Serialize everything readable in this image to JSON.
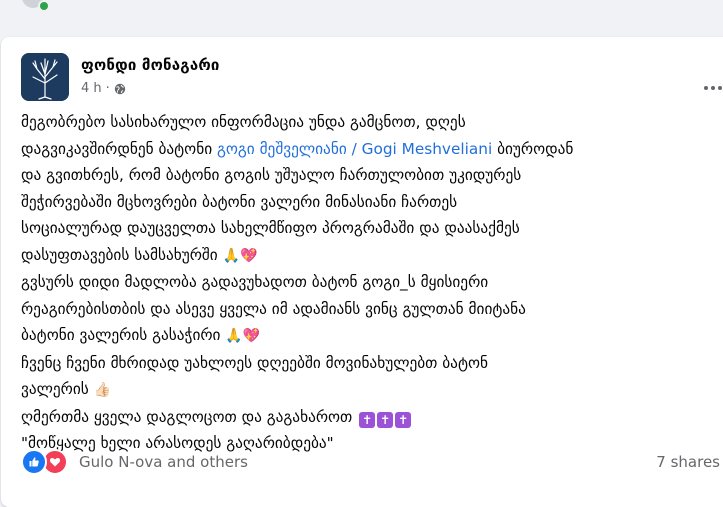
{
  "post": {
    "page_name": "ფონდი მონაგარი",
    "time": "4 h",
    "separator": "·",
    "audience_icon": "globe-icon",
    "more_icon": "more-icon",
    "lines": [
      {
        "text": "მეგობრებო სასიხარულო ინფორმაცია უნდა გამცნოთ, დღეს"
      },
      {
        "pre": "დაგვიკავშირდნენ ბატონი ",
        "link": "გოგი მეშველიანი / Gogi Meshveliani",
        "post": "  ბიუროდან"
      },
      {
        "text": "და გვითხრეს, რომ ბატონი გოგის უშუალო ჩართულობით უკიდურეს"
      },
      {
        "text": "შეჭირვებაში მცხოვრები ბატონი ვალერი მინასიანი ჩართეს"
      },
      {
        "text": "სოციალურად დაუცველთა სახელმწიფო პროგრამაში და დაასაქმეს"
      },
      {
        "text": "დასუფთავების სამსახურში",
        "emoji": "🙏💖"
      },
      {
        "text": "გვსურს დიდი მადლობა გადავუხადოთ ბატონ გოგი_ს მყისიერი"
      },
      {
        "text": "რეაგირებისთბის და ასევე ყველა იმ ადამიანს ვინც გულთან მიიტანა"
      },
      {
        "text": "ბატონი ვალერის გასაჭირი",
        "emoji": "🙏💖"
      },
      {
        "text": "ჩვენც ჩვენი მხრიდად უახლოეს დღეებში მოვინახულებთ ბატონ"
      },
      {
        "text": "ვალერის",
        "emoji": "👍🏻"
      },
      {
        "text": "ღმერთმა ყველა დაგლოცოთ და გაგახაროთ",
        "crosses": "✝✝✝"
      },
      {
        "text": "\"მოწყალე ხელი არასოდეს გაღარიბდება\""
      }
    ]
  },
  "footer": {
    "reactions_text": "Gulo N-ova and others",
    "shares_text": "7 shares",
    "like_icon": "like-icon",
    "love_icon": "love-icon"
  },
  "colors": {
    "link": "#216fdb",
    "text": "#050505",
    "secondary": "#65676b",
    "like": "#1877f2",
    "love": "#f33e58"
  }
}
